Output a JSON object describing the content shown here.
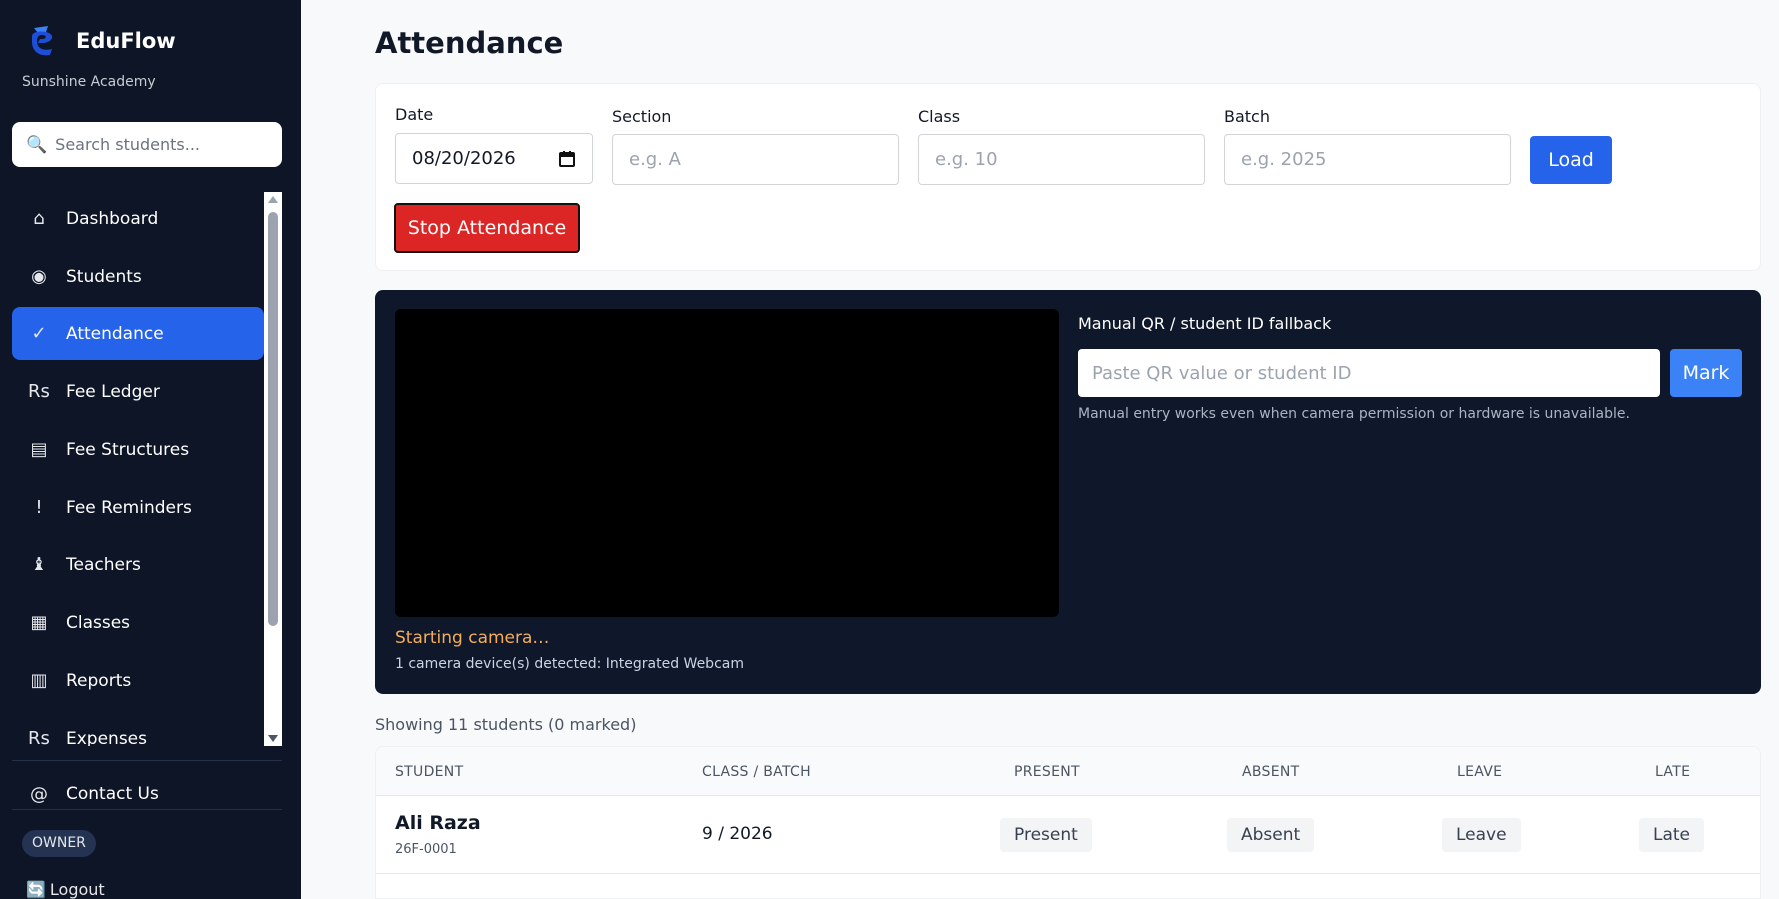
{
  "sidebar": {
    "brand": "EduFlow",
    "school": "Sunshine Academy",
    "search_placeholder": "Search students...",
    "items": [
      {
        "icon": "home-icon",
        "glyph": "⌂",
        "label": "Dashboard",
        "active": false
      },
      {
        "icon": "students-icon",
        "glyph": "◉",
        "label": "Students",
        "active": false
      },
      {
        "icon": "check-icon",
        "glyph": "✓",
        "label": "Attendance",
        "active": true
      },
      {
        "icon": "rupee-icon",
        "glyph": "Rs",
        "label": "Fee Ledger",
        "active": false
      },
      {
        "icon": "list-icon",
        "glyph": "▤",
        "label": "Fee Structures",
        "active": false
      },
      {
        "icon": "alert-icon",
        "glyph": "!",
        "label": "Fee Reminders",
        "active": false
      },
      {
        "icon": "teacher-icon",
        "glyph": "♝",
        "label": "Teachers",
        "active": false
      },
      {
        "icon": "grid-icon",
        "glyph": "▦",
        "label": "Classes",
        "active": false
      },
      {
        "icon": "report-icon",
        "glyph": "▥",
        "label": "Reports",
        "active": false
      },
      {
        "icon": "rupee-icon",
        "glyph": "Rs",
        "label": "Expenses",
        "active": false
      }
    ],
    "contact": {
      "glyph": "@",
      "label": "Contact Us"
    },
    "role": "OWNER",
    "logout": "Logout"
  },
  "page": {
    "title": "Attendance"
  },
  "filters": {
    "date_label": "Date",
    "date_value": "08/20/2026",
    "section_label": "Section",
    "section_placeholder": "e.g. A",
    "class_label": "Class",
    "class_placeholder": "e.g. 10",
    "batch_label": "Batch",
    "batch_placeholder": "e.g. 2025",
    "load_label": "Load",
    "stop_label": "Stop Attendance"
  },
  "scanner": {
    "status": "Starting camera…",
    "devices": "1 camera device(s) detected: Integrated Webcam",
    "manual_label": "Manual QR / student ID fallback",
    "manual_placeholder": "Paste QR value or student ID",
    "mark_label": "Mark",
    "hint": "Manual entry works even when camera permission or hardware is unavailable."
  },
  "summary": "Showing 11 students (0 marked)",
  "table": {
    "headers": [
      "STUDENT",
      "CLASS / BATCH",
      "PRESENT",
      "ABSENT",
      "LEAVE",
      "LATE"
    ],
    "rows": [
      {
        "name": "Ali Raza",
        "id": "26F-0001",
        "class_batch": "9 / 2026",
        "present": "Present",
        "absent": "Absent",
        "leave": "Leave",
        "late": "Late"
      }
    ]
  },
  "colors": {
    "sidebar_bg": "#0d1526",
    "accent": "#2563eb",
    "danger": "#dc2626",
    "scanner_bg": "#0f172a",
    "status_warning": "#f6ad55"
  }
}
